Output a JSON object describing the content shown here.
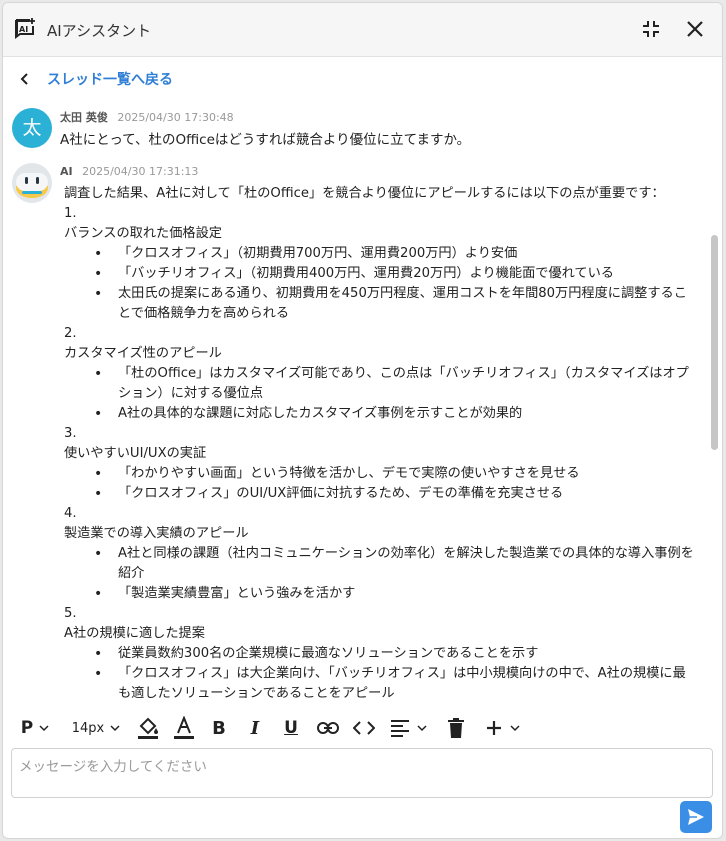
{
  "header": {
    "title": "AIアシスタント",
    "icons": {
      "app": "ai-chat-icon",
      "collapse": "collapse-icon",
      "close": "close-icon"
    }
  },
  "nav": {
    "back_label": "スレッド一覧へ戻る"
  },
  "messages": [
    {
      "author": "太田 英俊",
      "avatar_text": "太",
      "timestamp": "2025/04/30 17:30:48",
      "text": "A社にとって、杜のOfficeはどうすれば競合より優位に立てますか。"
    },
    {
      "author": "AI",
      "timestamp": "2025/04/30 17:31:13",
      "intro": "調査した結果、A社に対して「杜のOffice」を競合より優位にアピールするには以下の点が重要です：",
      "sections": [
        {
          "num": "1.",
          "heading": "バランスの取れた価格設定",
          "bullets": [
            "「クロスオフィス」（初期費用700万円、運用費200万円）より安価",
            "「バッチリオフィス」（初期費用400万円、運用費20万円）より機能面で優れている",
            "太田氏の提案にある通り、初期費用を450万円程度、運用コストを年間80万円程度に調整することで価格競争力を高められる"
          ]
        },
        {
          "num": "2.",
          "heading": "カスタマイズ性のアピール",
          "bullets": [
            "「杜のOffice」はカスタマイズ可能であり、この点は「バッチリオフィス」（カスタマイズはオプション）に対する優位点",
            "A社の具体的な課題に対応したカスタマイズ事例を示すことが効果的"
          ]
        },
        {
          "num": "3.",
          "heading": "使いやすいUI/UXの実証",
          "bullets": [
            "「わかりやすい画面」という特徴を活かし、デモで実際の使いやすさを見せる",
            "「クロスオフィス」のUI/UX評価に対抗するため、デモの準備を充実させる"
          ]
        },
        {
          "num": "4.",
          "heading": "製造業での導入実績のアピール",
          "bullets": [
            "A社と同様の課題（社内コミュニケーションの効率化）を解決した製造業での具体的な導入事例を紹介",
            "「製造業実績豊富」という強みを活かす"
          ]
        },
        {
          "num": "5.",
          "heading": "A社の規模に適した提案",
          "bullets": [
            "従業員数約300名の企業規模に最適なソリューションであることを示す",
            "「クロスオフィス」は大企業向け、「バッチリオフィス」は中小規模向けの中で、A社の規模に最も適したソリューションであることをアピール"
          ]
        }
      ]
    }
  ],
  "toolbar": {
    "font_size": "14px",
    "paragraph_label": "P"
  },
  "composer": {
    "placeholder": "メッセージを入力してください",
    "value": ""
  },
  "colors": {
    "accent": "#2f7fd6",
    "send": "#3a8ee6",
    "avatar": "#2bb0d6"
  }
}
